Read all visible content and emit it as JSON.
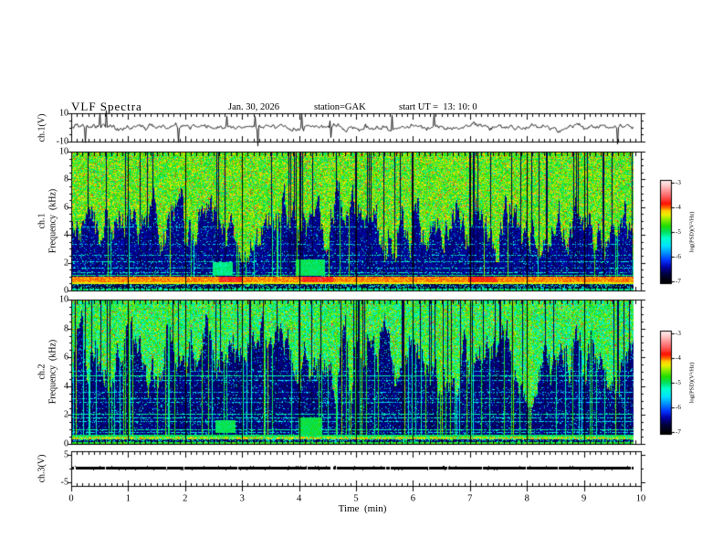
{
  "figure": {
    "title": "VLF Spectra",
    "date": "Jan. 30, 2026",
    "station": "station=GAK",
    "start_ut": "start UT =  13: 10: 0"
  },
  "xaxis": {
    "label": "Time  (min)",
    "ticks": [
      "0",
      "1",
      "2",
      "3",
      "4",
      "5",
      "6",
      "7",
      "8",
      "9",
      "10"
    ]
  },
  "panels": {
    "ch1_voltage": {
      "label": "ch.1(V)",
      "yticks": [
        "10",
        "-10"
      ]
    },
    "ch1_spec": {
      "label_ch": "ch.1",
      "label_axis": "Frequency  (kHz)",
      "yticks": [
        "10",
        "8",
        "6",
        "4",
        "2",
        "0"
      ]
    },
    "ch2_spec": {
      "label_ch": "ch.2",
      "label_axis": "Frequency  (kHz)",
      "yticks": [
        "10",
        "8",
        "6",
        "4",
        "2",
        "0"
      ]
    },
    "ch3_voltage": {
      "label": "ch.3(V)",
      "yticks": [
        "5",
        "-5"
      ]
    }
  },
  "colorbar": {
    "label": "log(PSD)(V²/Hz)",
    "ticks": [
      "-3",
      "-4",
      "-5",
      "-6",
      "-7"
    ],
    "gradient_stops": [
      [
        0.0,
        "#000000"
      ],
      [
        0.08,
        "#000038"
      ],
      [
        0.15,
        "#0000a0"
      ],
      [
        0.22,
        "#0033ff"
      ],
      [
        0.3,
        "#0099ff"
      ],
      [
        0.36,
        "#00e0ff"
      ],
      [
        0.44,
        "#00ffcc"
      ],
      [
        0.5,
        "#00e060"
      ],
      [
        0.56,
        "#22dd00"
      ],
      [
        0.63,
        "#99ee00"
      ],
      [
        0.67,
        "#eeee00"
      ],
      [
        0.71,
        "#ffcc00"
      ],
      [
        0.74,
        "#ff6600"
      ],
      [
        0.78,
        "#ff1100"
      ],
      [
        0.84,
        "#ff5555"
      ],
      [
        0.91,
        "#ff9999"
      ],
      [
        0.96,
        "#ffcccc"
      ],
      [
        1.0,
        "#ffe8e8"
      ]
    ]
  },
  "chart_data": [
    {
      "panel": "ch1_voltage",
      "type": "line",
      "xlabel": "Time (min)",
      "ylabel": "ch.1(V)",
      "xlim": [
        0,
        10
      ],
      "data_xmax": 9.8,
      "ylim": [
        -10,
        10
      ],
      "ytick_values": [
        10,
        -10
      ],
      "series_color": "#000000",
      "signal": {
        "kind": "broadband-noise",
        "mean_v": 0,
        "rms_v": 1.1,
        "spike_prob": 0.016,
        "spike_v_range": [
          3,
          8.5
        ]
      }
    },
    {
      "panel": "ch1_spec",
      "type": "heatmap",
      "ylabel": "ch.1 Frequency (kHz)",
      "xlim": [
        0,
        10
      ],
      "data_xmax": 9.8,
      "ylim_khz": [
        0,
        10
      ],
      "z_label": "log(PSD)(V²/Hz)",
      "z_range": [
        -7,
        -3
      ],
      "grid_minutes": true,
      "texture": {
        "flame_khz": [
          2.6,
          6.9
        ],
        "top_base": 0.58,
        "top_noise": 0.13,
        "p_red_speck": 0.05,
        "p_black_col": 0.07,
        "p_bright_col": 0.055,
        "mid_base": 0.085,
        "mid_noise": 0.1,
        "p_speck": 0.055,
        "hlines": [
          {
            "f": 4.65,
            "v": 0.4,
            "p": 0.45
          },
          {
            "f": 3.35,
            "v": 0.38,
            "p": 0.35
          },
          {
            "f": 2.6,
            "v": 0.4,
            "p": 0.45
          },
          {
            "f": 2.1,
            "v": 0.42,
            "p": 0.55
          },
          {
            "f": 1.65,
            "v": 0.4,
            "p": 0.5
          },
          {
            "f": 1.3,
            "v": 0.44,
            "p": 0.6
          },
          {
            "f": 1.12,
            "v": 0.5,
            "p": 0.9
          }
        ],
        "bands": [
          {
            "f0": 0.64,
            "f1": 1.0,
            "v": 0.73,
            "n": 0.06
          },
          {
            "f0": 0.52,
            "f1": 0.64,
            "v": 0.67,
            "n": 0.05
          },
          {
            "f0": 0.16,
            "f1": 0.52,
            "base": 0.1,
            "amp": 0.48,
            "p": 0.3,
            "speckle": true
          },
          {
            "f0": 0.0,
            "f1": 0.16,
            "v": 0.47,
            "n": 0.18
          }
        ],
        "blobs": [
          {
            "t0": 2.45,
            "t1": 2.8,
            "f0": 1.1,
            "f1": 2.1,
            "v": 0.48
          },
          {
            "t0": 3.9,
            "t1": 4.4,
            "f0": 1.1,
            "f1": 2.3,
            "v": 0.5
          },
          {
            "t0": 2.55,
            "t1": 2.95,
            "f0": 0.64,
            "f1": 1.0,
            "v": 0.8
          },
          {
            "t0": 4.0,
            "t1": 4.55,
            "f0": 0.64,
            "f1": 1.0,
            "v": 0.8
          },
          {
            "t0": 6.9,
            "t1": 7.4,
            "f0": 0.64,
            "f1": 1.0,
            "v": 0.78
          }
        ]
      }
    },
    {
      "panel": "ch2_spec",
      "type": "heatmap",
      "ylabel": "ch.2 Frequency (kHz)",
      "xlim": [
        0,
        10
      ],
      "data_xmax": 9.8,
      "ylim_khz": [
        0,
        10
      ],
      "z_label": "log(PSD)(V²/Hz)",
      "z_range": [
        -7,
        -3
      ],
      "grid_minutes": true,
      "texture": {
        "flame_khz": [
          3.2,
          8.2
        ],
        "top_base": 0.52,
        "top_noise": 0.15,
        "p_red_speck": 0.04,
        "p_black_col": 0.09,
        "p_bright_col": 0.13,
        "mid_base": 0.075,
        "mid_noise": 0.095,
        "p_speck": 0.06,
        "hlines": [
          {
            "f": 5.1,
            "v": 0.36,
            "p": 0.4
          },
          {
            "f": 4.75,
            "v": 0.46,
            "p": 0.9
          },
          {
            "f": 4.45,
            "v": 0.38,
            "p": 0.5
          },
          {
            "f": 3.6,
            "v": 0.36,
            "p": 0.45
          },
          {
            "f": 3.2,
            "v": 0.4,
            "p": 0.55
          },
          {
            "f": 2.9,
            "v": 0.36,
            "p": 0.45
          },
          {
            "f": 2.1,
            "v": 0.46,
            "p": 0.85
          },
          {
            "f": 1.85,
            "v": 0.42,
            "p": 0.7
          },
          {
            "f": 1.6,
            "v": 0.4,
            "p": 0.6
          },
          {
            "f": 1.05,
            "v": 0.46,
            "p": 0.85
          },
          {
            "f": 0.85,
            "v": 0.4,
            "p": 0.6
          }
        ],
        "bands": [
          {
            "f0": 0.56,
            "f1": 0.7,
            "v": 0.5,
            "n": 0.08
          },
          {
            "f0": 0.34,
            "f1": 0.56,
            "base": 0.45,
            "amp": 0.3,
            "p": 0.75,
            "speckle": true
          },
          {
            "f0": 0.14,
            "f1": 0.34,
            "base": 0.12,
            "amp": 0.45,
            "p": 0.35,
            "speckle": true
          },
          {
            "f0": 0.0,
            "f1": 0.14,
            "v": 0.55,
            "n": 0.15
          }
        ],
        "blobs": [
          {
            "t0": 2.5,
            "t1": 2.85,
            "f0": 0.8,
            "f1": 1.7,
            "v": 0.5
          },
          {
            "t0": 3.95,
            "t1": 4.35,
            "f0": 0.7,
            "f1": 1.9,
            "v": 0.52
          }
        ]
      }
    },
    {
      "panel": "ch3_voltage",
      "type": "line",
      "ylabel": "ch.3(V)",
      "xlim": [
        0,
        10
      ],
      "data_xmax": 9.8,
      "ylim": [
        -5,
        5
      ],
      "ytick_values": [
        5,
        -5
      ],
      "series_color": "#000000",
      "signal": {
        "kind": "constant",
        "value_v": 0,
        "appearance": "thick flat black trace"
      }
    }
  ]
}
